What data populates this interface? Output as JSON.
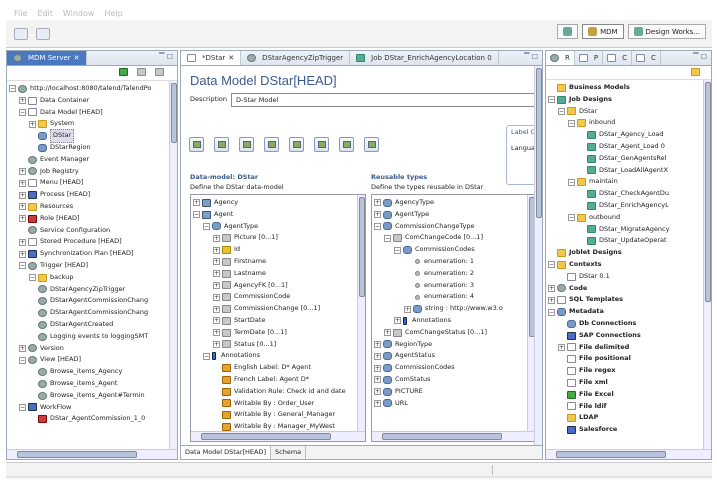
{
  "menu": [
    "File",
    "Edit",
    "Window",
    "Help"
  ],
  "perspectives": {
    "mdm": "MDM",
    "design": "Design Works..."
  },
  "left_panel": {
    "tab": "MDM Server",
    "tree": [
      {
        "depth": 0,
        "exp": "-",
        "icon": "gear",
        "label": "http://localhost:8080/talend/TalendPo"
      },
      {
        "depth": 1,
        "exp": "+",
        "icon": "doc",
        "label": "Data Container"
      },
      {
        "depth": 1,
        "exp": "-",
        "icon": "doc",
        "label": "Data Model [HEAD]"
      },
      {
        "depth": 2,
        "exp": "+",
        "icon": "folder",
        "label": "System"
      },
      {
        "depth": 2,
        "exp": "",
        "icon": "db",
        "label": "DStar",
        "selected": true
      },
      {
        "depth": 2,
        "exp": "",
        "icon": "db",
        "label": "DStarRegion"
      },
      {
        "depth": 1,
        "exp": "",
        "icon": "gear",
        "label": "Event Manager"
      },
      {
        "depth": 1,
        "exp": "+",
        "icon": "gear",
        "label": "Job Registry"
      },
      {
        "depth": 1,
        "exp": "+",
        "icon": "doc",
        "label": "Menu [HEAD]"
      },
      {
        "depth": 1,
        "exp": "+",
        "icon": "blue",
        "label": "Process [HEAD]"
      },
      {
        "depth": 1,
        "exp": "+",
        "icon": "folder",
        "label": "Resources"
      },
      {
        "depth": 1,
        "exp": "+",
        "icon": "red",
        "label": "Role [HEAD]"
      },
      {
        "depth": 1,
        "exp": "",
        "icon": "gear",
        "label": "Service Configuration"
      },
      {
        "depth": 1,
        "exp": "+",
        "icon": "doc",
        "label": "Stored Procedure [HEAD]"
      },
      {
        "depth": 1,
        "exp": "+",
        "icon": "blue",
        "label": "Synchronization Plan [HEAD]"
      },
      {
        "depth": 1,
        "exp": "-",
        "icon": "gear",
        "label": "Trigger [HEAD]"
      },
      {
        "depth": 2,
        "exp": "-",
        "icon": "folder",
        "label": "backup"
      },
      {
        "depth": 2,
        "exp": "",
        "icon": "gear",
        "label": "DStarAgencyZipTrigger"
      },
      {
        "depth": 2,
        "exp": "",
        "icon": "gear",
        "label": "DStarAgentCommissionChang"
      },
      {
        "depth": 2,
        "exp": "",
        "icon": "gear",
        "label": "DStarAgentCommissionChang"
      },
      {
        "depth": 2,
        "exp": "",
        "icon": "gear",
        "label": "DStarAgentCreated"
      },
      {
        "depth": 2,
        "exp": "",
        "icon": "gear",
        "label": "Logging events to loggingSMT"
      },
      {
        "depth": 1,
        "exp": "+",
        "icon": "gear",
        "label": "Version"
      },
      {
        "depth": 1,
        "exp": "-",
        "icon": "gear",
        "label": "View [HEAD]"
      },
      {
        "depth": 2,
        "exp": "",
        "icon": "gear",
        "label": "Browse_items_Agency"
      },
      {
        "depth": 2,
        "exp": "",
        "icon": "gear",
        "label": "Browse_items_Agent"
      },
      {
        "depth": 2,
        "exp": "",
        "icon": "gear",
        "label": "Browse_items_Agent#Termin"
      },
      {
        "depth": 1,
        "exp": "-",
        "icon": "blue",
        "label": "WorkFlow"
      },
      {
        "depth": 2,
        "exp": "",
        "icon": "red",
        "label": "DStar_AgentCommission_1_0"
      }
    ]
  },
  "editor": {
    "tabs": [
      "*DStar",
      "DStarAgencyZipTrigger",
      "Job DStar_EnrichAgencyLocation 0"
    ],
    "title": "Data Model DStar[HEAD]",
    "description_label": "Description",
    "description_value": "D-Star Model",
    "label_options_title": "Label Op",
    "label_options_lang": "Languag",
    "datamodel_title": "Data-model: DStar",
    "datamodel_desc": "Define the DStar data-model",
    "reusable_title": "Reusable types",
    "reusable_desc": "Define the types reusable in DStar",
    "datamodel_tree": [
      {
        "depth": 0,
        "exp": "+",
        "icon": "elem",
        "label": "Agency"
      },
      {
        "depth": 0,
        "exp": "-",
        "icon": "elem",
        "label": "Agent"
      },
      {
        "depth": 1,
        "exp": "-",
        "icon": "db",
        "label": "AgentType"
      },
      {
        "depth": 2,
        "exp": "+",
        "icon": "attr",
        "label": "Picture  [0...1]"
      },
      {
        "depth": 2,
        "exp": "+",
        "icon": "key",
        "label": "Id"
      },
      {
        "depth": 2,
        "exp": "+",
        "icon": "attr",
        "label": "Firstname"
      },
      {
        "depth": 2,
        "exp": "+",
        "icon": "attr",
        "label": "Lastname"
      },
      {
        "depth": 2,
        "exp": "+",
        "icon": "attr",
        "label": "AgencyFK  [0...1]"
      },
      {
        "depth": 2,
        "exp": "+",
        "icon": "attr",
        "label": "CommissionCode"
      },
      {
        "depth": 2,
        "exp": "+",
        "icon": "attr",
        "label": "CommissionChange  [0...1]"
      },
      {
        "depth": 2,
        "exp": "+",
        "icon": "attr",
        "label": "StartDate"
      },
      {
        "depth": 2,
        "exp": "+",
        "icon": "attr",
        "label": "TermDate  [0...1]"
      },
      {
        "depth": 2,
        "exp": "+",
        "icon": "attr",
        "label": "Status  [0...1]"
      },
      {
        "depth": 1,
        "exp": "-",
        "icon": "arrow",
        "label": "Annotations"
      },
      {
        "depth": 2,
        "exp": "",
        "icon": "ann",
        "label": "English Label: D* Agent"
      },
      {
        "depth": 2,
        "exp": "",
        "icon": "ann",
        "label": "French Label: Agent D*"
      },
      {
        "depth": 2,
        "exp": "",
        "icon": "ann",
        "label": "Validation Rule: Check id and date"
      },
      {
        "depth": 2,
        "exp": "",
        "icon": "ann",
        "label": "Writable By : Order_User"
      },
      {
        "depth": 2,
        "exp": "",
        "icon": "ann",
        "label": "Writable By : General_Manager"
      },
      {
        "depth": 2,
        "exp": "",
        "icon": "ann",
        "label": "Writable By : Manager_MyWest"
      }
    ],
    "reusable_tree": [
      {
        "depth": 0,
        "exp": "+",
        "icon": "db",
        "label": "AgencyType"
      },
      {
        "depth": 0,
        "exp": "+",
        "icon": "db",
        "label": "AgentType"
      },
      {
        "depth": 0,
        "exp": "-",
        "icon": "db",
        "label": "CommissionChangeType"
      },
      {
        "depth": 1,
        "exp": "-",
        "icon": "attr",
        "label": "ComChangeCode  [0...1]"
      },
      {
        "depth": 2,
        "exp": "-",
        "icon": "db",
        "label": "CommissionCodes"
      },
      {
        "depth": 3,
        "exp": "",
        "icon": "dot",
        "label": "enumeration: 1"
      },
      {
        "depth": 3,
        "exp": "",
        "icon": "dot",
        "label": "enumeration: 2"
      },
      {
        "depth": 3,
        "exp": "",
        "icon": "dot",
        "label": "enumeration: 3"
      },
      {
        "depth": 3,
        "exp": "",
        "icon": "dot",
        "label": "enumeration: 4"
      },
      {
        "depth": 3,
        "exp": "+",
        "icon": "db",
        "label": "string : http://www.w3.o"
      },
      {
        "depth": 2,
        "exp": "+",
        "icon": "arrow",
        "label": "Annotations"
      },
      {
        "depth": 1,
        "exp": "+",
        "icon": "attr",
        "label": "ComChangeStatus  [0...1]"
      },
      {
        "depth": 0,
        "exp": "+",
        "icon": "db",
        "label": "RegionType"
      },
      {
        "depth": 0,
        "exp": "+",
        "icon": "db",
        "label": "AgentStatus"
      },
      {
        "depth": 0,
        "exp": "+",
        "icon": "db",
        "label": "CommissionCodes"
      },
      {
        "depth": 0,
        "exp": "+",
        "icon": "db",
        "label": "ComStatus"
      },
      {
        "depth": 0,
        "exp": "+",
        "icon": "db",
        "label": "PICTURE"
      },
      {
        "depth": 0,
        "exp": "+",
        "icon": "db",
        "label": "URL"
      }
    ],
    "bottom_tabs": [
      "Data Model DStar[HEAD]",
      "Schema"
    ]
  },
  "right_panel": {
    "tabs": [
      "R",
      "P",
      "C",
      "C"
    ],
    "tree": [
      {
        "depth": 0,
        "exp": "",
        "icon": "folder",
        "label": "Business Models",
        "bold": true
      },
      {
        "depth": 0,
        "exp": "-",
        "icon": "job",
        "label": "Job Designs",
        "bold": true
      },
      {
        "depth": 1,
        "exp": "-",
        "icon": "folder",
        "label": "DStar"
      },
      {
        "depth": 2,
        "exp": "-",
        "icon": "folder",
        "label": "inbound"
      },
      {
        "depth": 3,
        "exp": "",
        "icon": "job",
        "label": "DStar_Agency_Load"
      },
      {
        "depth": 3,
        "exp": "",
        "icon": "job",
        "label": "DStar_Agent_Load 0"
      },
      {
        "depth": 3,
        "exp": "",
        "icon": "job",
        "label": "DStar_GenAgentsRel"
      },
      {
        "depth": 3,
        "exp": "",
        "icon": "job",
        "label": "DStar_LoadAllAgentX"
      },
      {
        "depth": 2,
        "exp": "-",
        "icon": "folder",
        "label": "maintain"
      },
      {
        "depth": 3,
        "exp": "",
        "icon": "job",
        "label": "DStar_CheckAgentDu"
      },
      {
        "depth": 3,
        "exp": "",
        "icon": "job",
        "label": "DStar_EnrichAgencyL"
      },
      {
        "depth": 2,
        "exp": "-",
        "icon": "folder",
        "label": "outbound"
      },
      {
        "depth": 3,
        "exp": "",
        "icon": "job",
        "label": "DStar_MigrateAgency"
      },
      {
        "depth": 3,
        "exp": "",
        "icon": "job",
        "label": "DStar_UpdateOperat"
      },
      {
        "depth": 0,
        "exp": "",
        "icon": "folder",
        "label": "Joblet Designs",
        "bold": true
      },
      {
        "depth": 0,
        "exp": "-",
        "icon": "folder",
        "label": "Contexts",
        "bold": true
      },
      {
        "depth": 1,
        "exp": "",
        "icon": "doc",
        "label": "DStar 0.1"
      },
      {
        "depth": 0,
        "exp": "+",
        "icon": "gear",
        "label": "Code",
        "bold": true
      },
      {
        "depth": 0,
        "exp": "+",
        "icon": "doc",
        "label": "SQL Templates",
        "bold": true
      },
      {
        "depth": 0,
        "exp": "-",
        "icon": "db",
        "label": "Metadata",
        "bold": true
      },
      {
        "depth": 1,
        "exp": "",
        "icon": "db",
        "label": "Db Connections",
        "bold": true
      },
      {
        "depth": 1,
        "exp": "",
        "icon": "blue",
        "label": "SAP Connections",
        "bold": true
      },
      {
        "depth": 1,
        "exp": "+",
        "icon": "doc",
        "label": "File delimited",
        "bold": true
      },
      {
        "depth": 1,
        "exp": "",
        "icon": "doc",
        "label": "File positional",
        "bold": true
      },
      {
        "depth": 1,
        "exp": "",
        "icon": "doc",
        "label": "File regex",
        "bold": true
      },
      {
        "depth": 1,
        "exp": "",
        "icon": "doc",
        "label": "File xml",
        "bold": true
      },
      {
        "depth": 1,
        "exp": "",
        "icon": "green",
        "label": "File Excel",
        "bold": true
      },
      {
        "depth": 1,
        "exp": "",
        "icon": "doc",
        "label": "File ldif",
        "bold": true
      },
      {
        "depth": 1,
        "exp": "",
        "icon": "folder",
        "label": "LDAP",
        "bold": true
      },
      {
        "depth": 1,
        "exp": "",
        "icon": "blue",
        "label": "Salesforce",
        "bold": true
      }
    ]
  }
}
